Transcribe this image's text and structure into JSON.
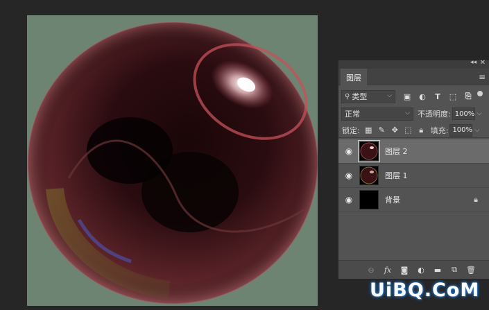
{
  "panel": {
    "tab_label": "图层",
    "collapse_glyph": "◂◂",
    "close_glyph": "✕",
    "menu_glyph": "≡"
  },
  "filter": {
    "kind_label": "类型",
    "icons": [
      "pixel-filter-icon",
      "adjustment-filter-icon",
      "type-filter-icon",
      "shape-filter-icon",
      "smart-object-filter-icon"
    ]
  },
  "blend": {
    "mode": "正常",
    "opacity_label": "不透明度:",
    "opacity_value": "100%"
  },
  "lock": {
    "label": "锁定:",
    "fill_label": "填充:",
    "fill_value": "100%"
  },
  "layers": [
    {
      "name": "图层 2",
      "selected": true,
      "thumbnail": "sphere"
    },
    {
      "name": "图层 1",
      "selected": false,
      "thumbnail": "sphere"
    },
    {
      "name": "背景",
      "selected": false,
      "thumbnail": "black",
      "locked": true
    }
  ],
  "bottom_icons": [
    "link-layers-icon",
    "fx-icon",
    "add-mask-icon",
    "adjustment-layer-icon",
    "new-group-icon",
    "new-layer-icon",
    "delete-icon"
  ],
  "fx_label": "fx",
  "watermark": "UiBQ.CoM",
  "colors": {
    "canvas_bg": "#6d8472",
    "sphere": "#4a1f22",
    "selected_layer": "#6b6b6b"
  }
}
